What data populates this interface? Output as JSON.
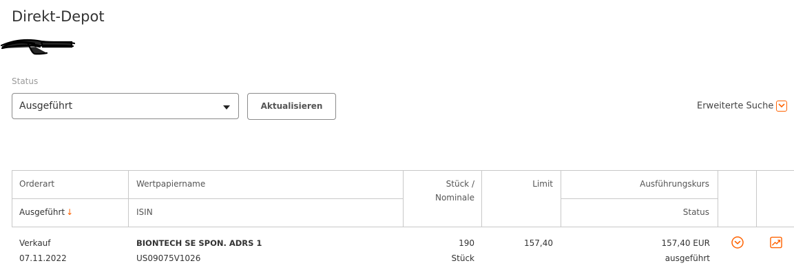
{
  "page": {
    "title": "Direkt-Depot"
  },
  "filter": {
    "status_label": "Status",
    "status_value": "Ausgeführt",
    "refresh_label": "Aktualisieren",
    "advanced_search_label": "Erweiterte Suche"
  },
  "table": {
    "headers": {
      "orderart": "Orderart",
      "wertpapiername": "Wertpapiername",
      "stueck_line1": "Stück /",
      "stueck_line2": "Nominale",
      "limit": "Limit",
      "ausfuehrungskurs": "Ausführungskurs",
      "ausgefuehrt": "Ausgeführt",
      "sort_icon": "arrow-down-icon",
      "isin": "ISIN",
      "status": "Status"
    },
    "rows": [
      {
        "orderart": "Verkauf",
        "date": "07.11.2022",
        "name": "BIONTECH SE SPON. ADRS 1",
        "isin": "US09075V1026",
        "quantity": "190",
        "unit": "Stück",
        "limit": "157,40",
        "price": "157,40 EUR",
        "status": "ausgeführt"
      }
    ]
  },
  "colors": {
    "accent": "#ff6200",
    "border": "#c8c8c8",
    "text": "#333333",
    "muted": "#9a9a9a"
  }
}
